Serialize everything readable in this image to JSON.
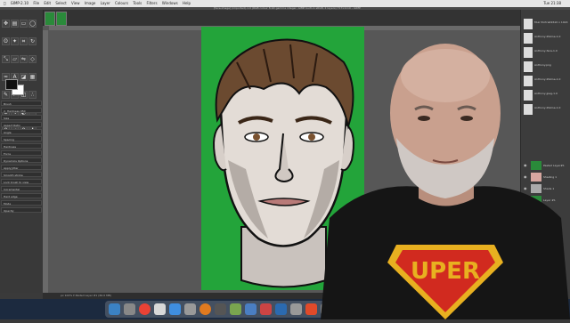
{
  "menubar": {
    "app": "GIMP-2.10",
    "items": [
      "File",
      "Edit",
      "Select",
      "View",
      "Image",
      "Layer",
      "Colours",
      "Tools",
      "Filters",
      "Windows",
      "Help"
    ],
    "clock": "Tue 21:38"
  },
  "window": {
    "title": "[face-image] (imported)-1.0 (RGB colour 8-bit gamma integer, GIMP built-in sRGB, 2 layers) 717x1110 – GIMP"
  },
  "tool_options": {
    "title": "Brush",
    "brush": "2. Hardness 050",
    "rows": [
      "Size",
      "Aspect Ratio",
      "Angle",
      "Spacing",
      "Hardness",
      "Force"
    ],
    "dynamics": "Dynamics Options",
    "dyn_items": [
      "Apply Jitter",
      "Smooth stroke",
      "Lock brush to view",
      "Incremental",
      "Hard edge"
    ],
    "mode": "Mode",
    "opacity": "Opacity"
  },
  "status": {
    "text": "px  100% ▾  Pasted Layer #1 (60.0 MB)"
  },
  "images": [
    {
      "label": "Muir Portrait2610 x 1024"
    },
    {
      "label": "Anthony-lifeline-1.0"
    },
    {
      "label": "Anthony-face-1.0"
    },
    {
      "label": "Anthony.png"
    },
    {
      "label": "Anthony-lifeline-1.0"
    },
    {
      "label": "Anthony-jpeg-1.0"
    },
    {
      "label": "Anthony-lifeline-1.0"
    }
  ],
  "layers": [
    {
      "label": "Pasted Layer#1",
      "color": "#2a8a3a"
    },
    {
      "label": "Shading 1",
      "color": "#d7a7a0"
    },
    {
      "label": "Shade 1",
      "color": "#aaaaaa"
    },
    {
      "label": "Layer #1",
      "color": "#2a8a3a"
    }
  ],
  "overlay": {
    "shirt_text": "UPER"
  },
  "dock_colors": [
    "#3b82c4",
    "#888",
    "#e94235",
    "#d8d8d8",
    "#3f8ee0",
    "#999",
    "#e07a1f",
    "#555",
    "#79a54f",
    "#4a7ec2",
    "#c44",
    "#2b6ab0",
    "#999",
    "#e04a2a",
    "#8c8c8c"
  ]
}
